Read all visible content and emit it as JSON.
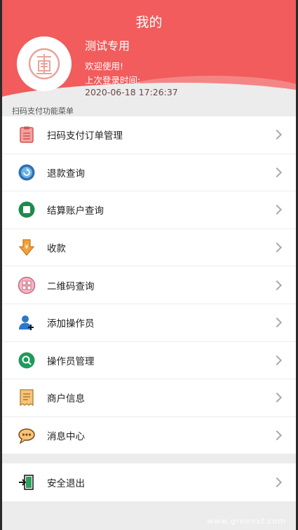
{
  "header": {
    "title": "我的",
    "user_name": "测试专用",
    "welcome": "欢迎使用!",
    "last_login_label": "上次登录时间:",
    "last_login_time": "2020-06-18 17:26:37",
    "accent_color": "#f25c5c"
  },
  "section_label": "扫码支付功能菜单",
  "menu": [
    {
      "label": "扫码支付订单管理",
      "icon": "clipboard-icon"
    },
    {
      "label": "退款查询",
      "icon": "refund-icon"
    },
    {
      "label": "结算账户查询",
      "icon": "account-icon"
    },
    {
      "label": "收款",
      "icon": "receive-money-icon"
    },
    {
      "label": "二维码查询",
      "icon": "qrcode-icon"
    },
    {
      "label": "添加操作员",
      "icon": "add-user-icon"
    },
    {
      "label": "操作员管理",
      "icon": "search-operator-icon"
    },
    {
      "label": "商户信息",
      "icon": "merchant-icon"
    },
    {
      "label": "消息中心",
      "icon": "message-icon"
    }
  ],
  "exit": {
    "label": "安全退出",
    "icon": "exit-icon"
  },
  "watermark": "www.greenxf.com"
}
